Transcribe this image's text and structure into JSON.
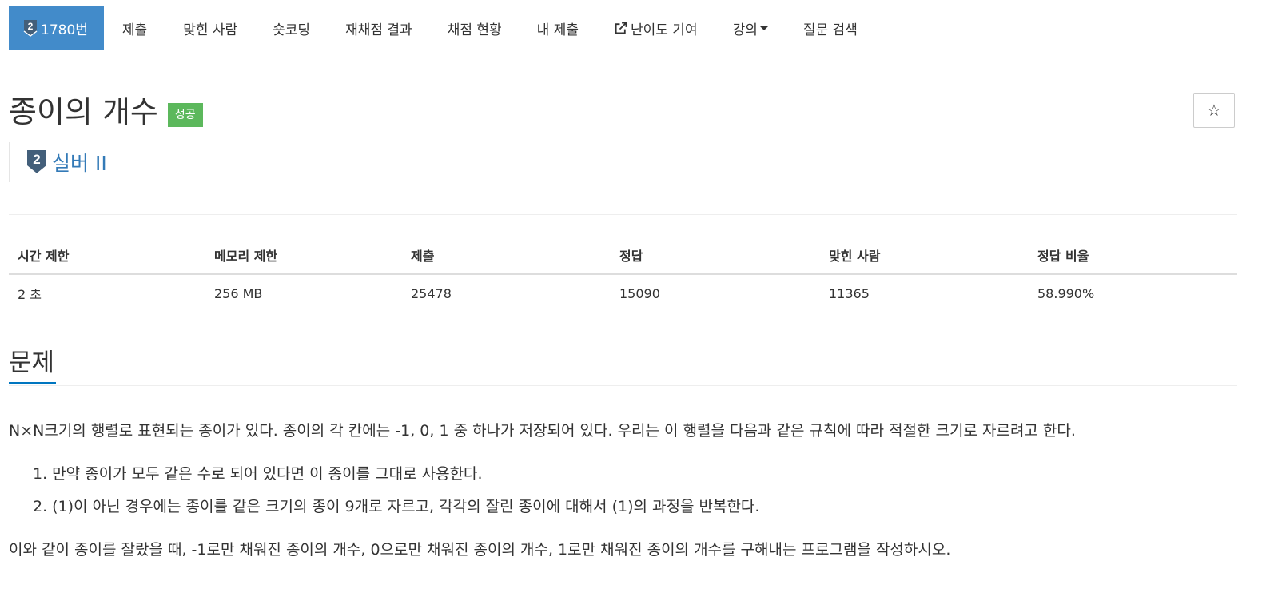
{
  "nav": {
    "problem_tab": "1780번",
    "tier_number": "2",
    "items": [
      "제출",
      "맞힌 사람",
      "숏코딩",
      "재채점 결과",
      "채점 현황",
      "내 제출"
    ],
    "difficulty_contribute": "난이도 기여",
    "lecture": "강의",
    "question_search": "질문 검색"
  },
  "problem": {
    "title": "종이의 개수",
    "status": "성공",
    "tier_label": "실버 II",
    "star": "☆"
  },
  "stats": {
    "headers": [
      "시간 제한",
      "메모리 제한",
      "제출",
      "정답",
      "맞힌 사람",
      "정답 비율"
    ],
    "values": [
      "2 초",
      "256 MB",
      "25478",
      "15090",
      "11365",
      "58.990%"
    ]
  },
  "description": {
    "heading": "문제",
    "intro": "N×N크기의 행렬로 표현되는 종이가 있다. 종이의 각 칸에는 -1, 0, 1 중 하나가 저장되어 있다. 우리는 이 행렬을 다음과 같은 규칙에 따라 적절한 크기로 자르려고 한다.",
    "rules": [
      "1. 만약 종이가 모두 같은 수로 되어 있다면 이 종이를 그대로 사용한다.",
      "2. (1)이 아닌 경우에는 종이를 같은 크기의 종이 9개로 자르고, 각각의 잘린 종이에 대해서 (1)의 과정을 반복한다."
    ],
    "outro": "이와 같이 종이를 잘랐을 때, -1로만 채워진 종이의 개수, 0으로만 채워진 종이의 개수, 1로만 채워진 종이의 개수를 구해내는 프로그램을 작성하시오."
  },
  "colors": {
    "nav_active": "#428bca",
    "success_badge": "#5cb85c",
    "tier_text": "#337ab7",
    "section_underline": "#0076c0"
  },
  "icons": [
    "silver-tier-icon",
    "external-link-icon",
    "caret-down-icon",
    "star-icon"
  ]
}
